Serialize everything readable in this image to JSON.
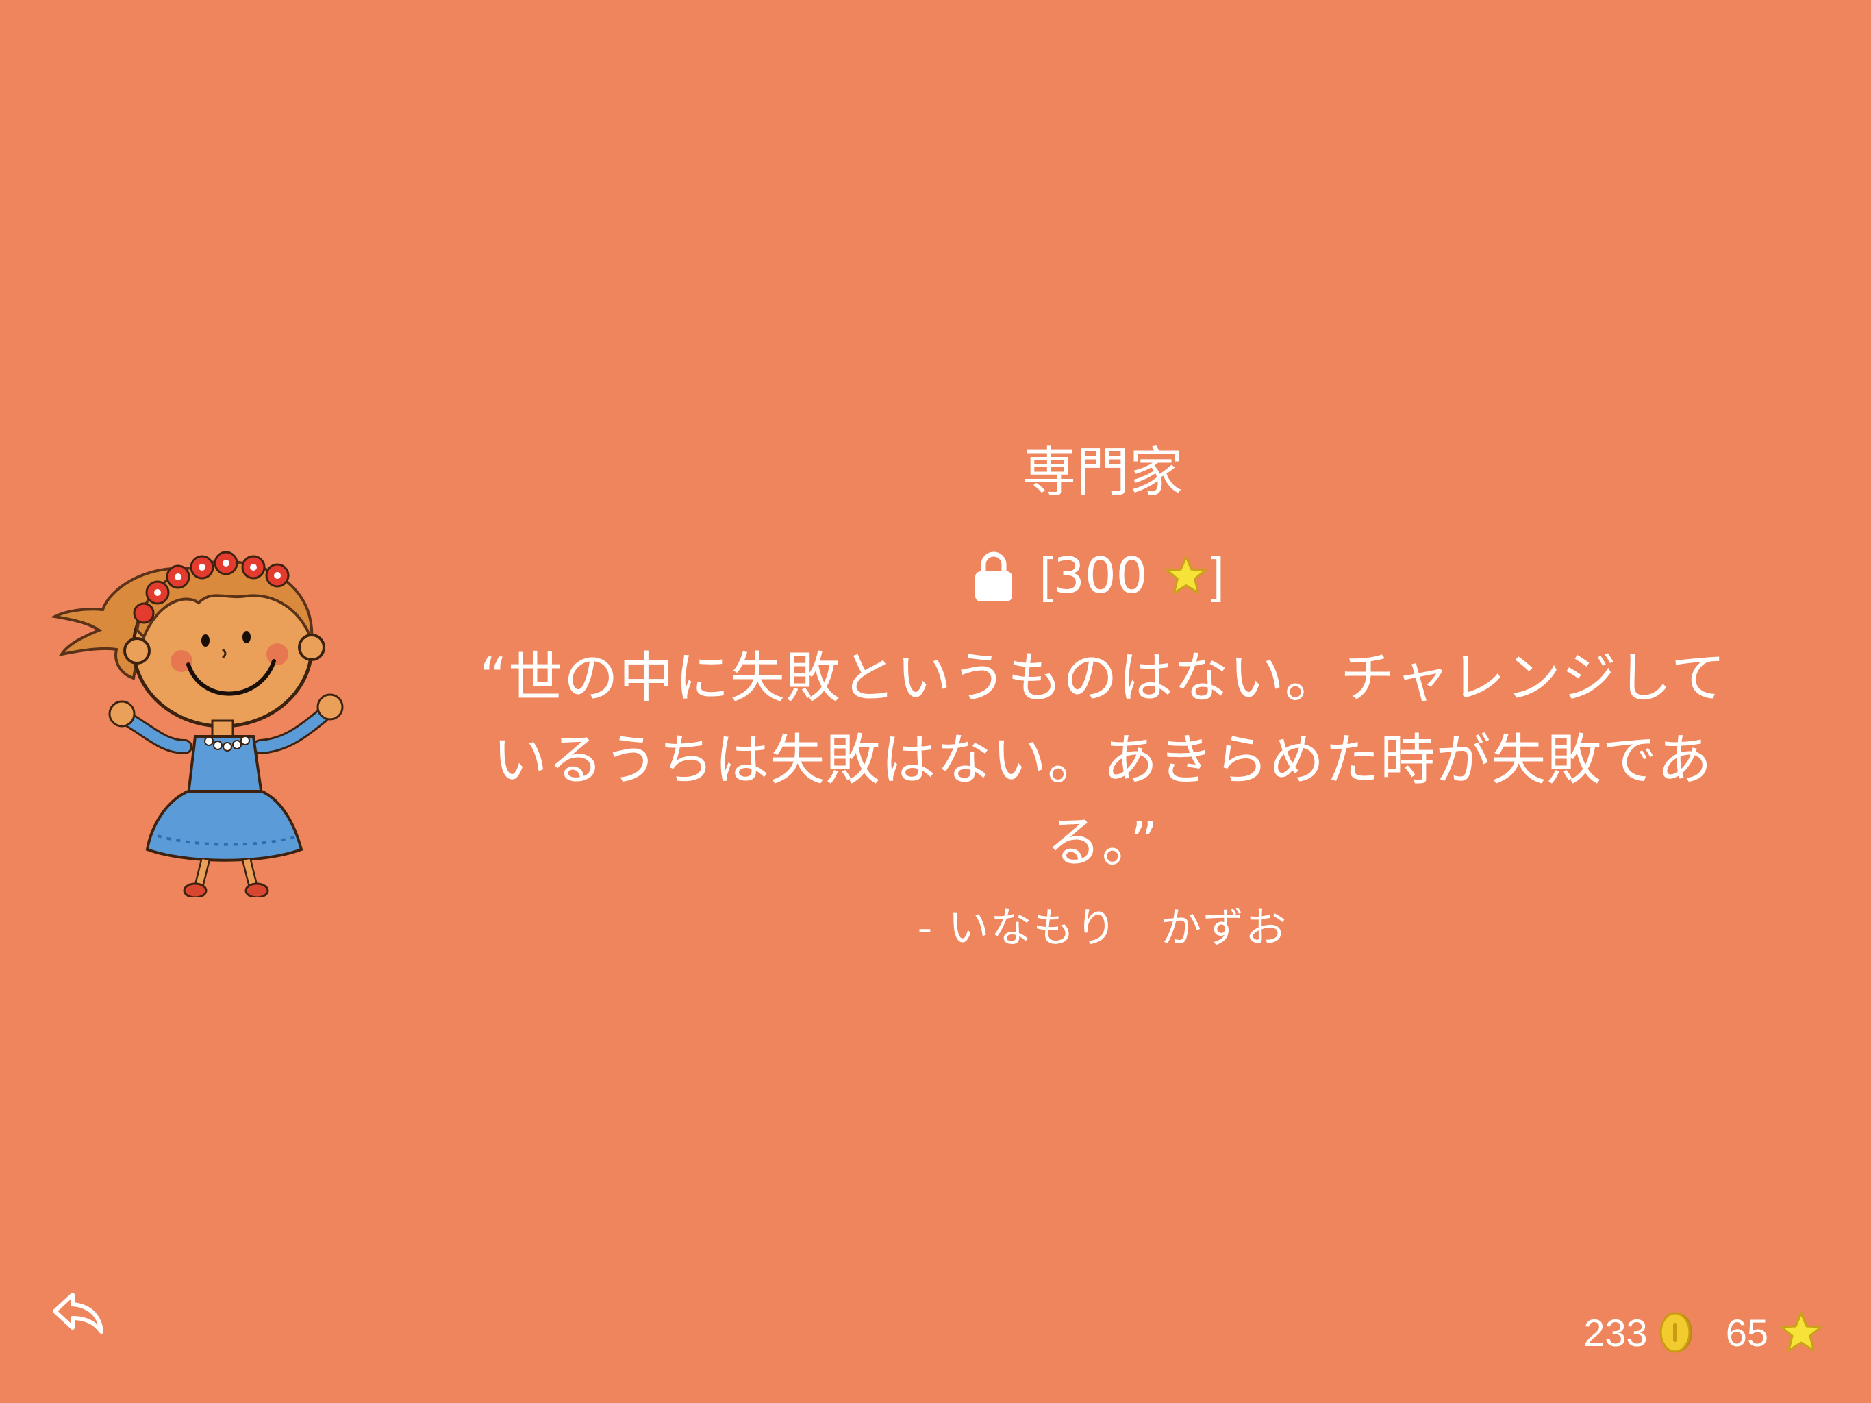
{
  "title": "専門家",
  "unlock": {
    "open_bracket": "[",
    "cost": "300",
    "close_bracket": "]",
    "lock_icon": "lock-icon",
    "star_icon": "star-icon"
  },
  "quote": {
    "text": "“世の中に失敗というものはない。チャレンジしているうちは失敗はない。あきらめた時が失敗である。”",
    "author": "- いなもり　かずお"
  },
  "stats": {
    "coins": "233",
    "coin_icon": "coin-icon",
    "stars": "65",
    "star_icon": "star-icon"
  },
  "navigation": {
    "back_icon": "back-arrow-icon"
  },
  "colors": {
    "background": "#EE855C",
    "text": "#FFFFFF",
    "star": "#F7E23A",
    "coin": "#E2B81E"
  }
}
